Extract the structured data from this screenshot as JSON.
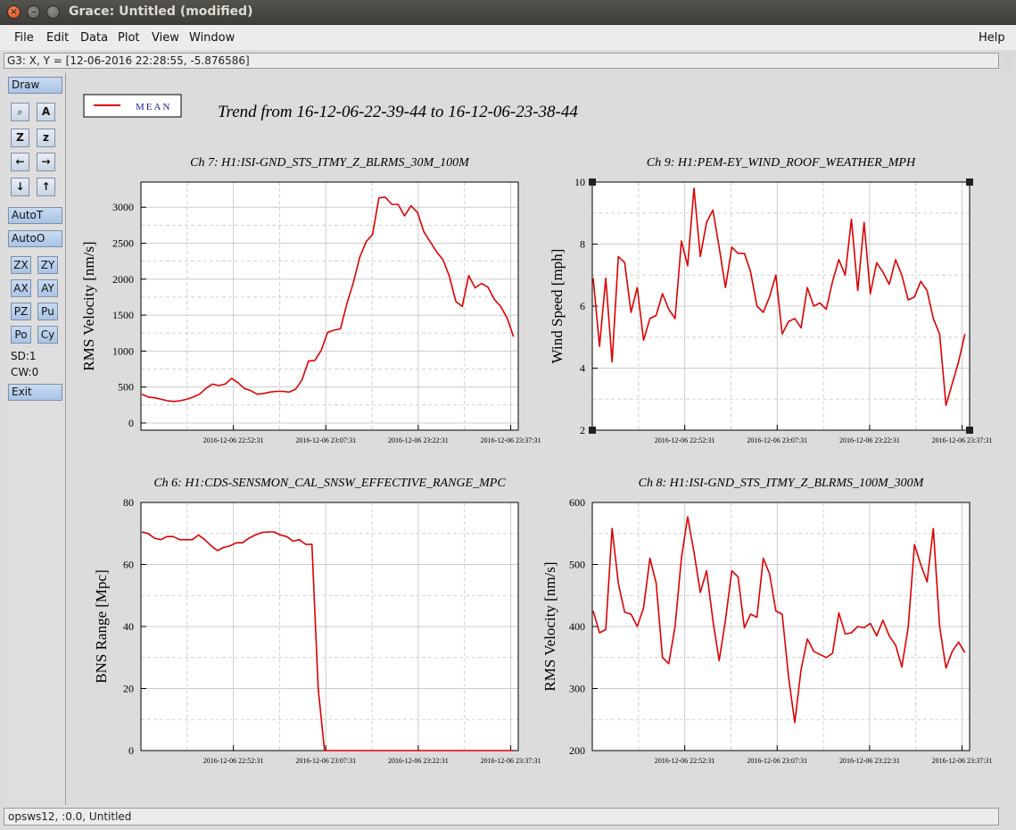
{
  "window": {
    "title": "Grace: Untitled (modified)",
    "close_glyph": "×",
    "minimize_glyph": "–"
  },
  "menubar": {
    "items": [
      {
        "label": "File",
        "accel": "F"
      },
      {
        "label": "Edit",
        "accel": "E"
      },
      {
        "label": "Data",
        "accel": "D"
      },
      {
        "label": "Plot",
        "accel": "P"
      },
      {
        "label": "View",
        "accel": "V"
      },
      {
        "label": "Window",
        "accel": "W"
      }
    ],
    "help": "Help"
  },
  "locator": "G3: X, Y = [12-06-2016 22:28:55, -5.876586]",
  "toolbar": {
    "draw": "Draw",
    "icons": [
      {
        "name": "zoom-icon",
        "glyph": "🔍"
      },
      {
        "name": "text-icon",
        "glyph": "A"
      },
      {
        "name": "zoom-z-icon",
        "glyph": "Z"
      },
      {
        "name": "zoom-out-icon",
        "glyph": "z"
      },
      {
        "name": "arrow-left-icon",
        "glyph": "←"
      },
      {
        "name": "arrow-right-icon",
        "glyph": "→"
      },
      {
        "name": "arrow-down-icon",
        "glyph": "↓"
      },
      {
        "name": "arrow-up-icon",
        "glyph": "↑"
      }
    ],
    "autot": "AutoT",
    "autoo": "AutoO",
    "small": [
      "ZX",
      "ZY",
      "AX",
      "AY",
      "PZ",
      "Pu",
      "Po",
      "Cy"
    ],
    "sd": "SD:1",
    "cw": "CW:0",
    "exit": "Exit"
  },
  "status": "opsws12, :0.0, Untitled",
  "legend": {
    "label": "MEAN",
    "color": "#dd0000"
  },
  "title": "Trend from 16-12-06-22-39-44 to 16-12-06-23-38-44",
  "chart_data": [
    {
      "type": "line",
      "title": "Ch 7: H1:ISI-GND_STS_ITMY_Z_BLRMS_30M_100M",
      "ylabel": "RMS Velocity [nm/s]",
      "xlabel": "",
      "xticks": [
        "2016-12-06 22:52:31",
        "2016-12-06 23:07:31",
        "2016-12-06 23:22:31",
        "2016-12-06 23:37:31"
      ],
      "yticks": [
        0,
        500,
        1000,
        1500,
        2000,
        2500,
        3000
      ],
      "ylim": [
        -100,
        3350
      ],
      "grid": true,
      "series": [
        {
          "name": "MEAN",
          "color": "#dd0000",
          "values": [
            400,
            360,
            350,
            330,
            310,
            300,
            310,
            330,
            360,
            400,
            480,
            540,
            520,
            540,
            620,
            560,
            480,
            450,
            400,
            410,
            430,
            440,
            440,
            430,
            470,
            600,
            860,
            870,
            1010,
            1260,
            1290,
            1310,
            1660,
            1950,
            2300,
            2520,
            2620,
            3130,
            3140,
            3040,
            3040,
            2880,
            3020,
            2930,
            2660,
            2520,
            2380,
            2270,
            2040,
            1690,
            1620,
            2050,
            1880,
            1940,
            1890,
            1720,
            1620,
            1460,
            1200
          ]
        }
      ]
    },
    {
      "type": "line",
      "title": "Ch 9: H1:PEM-EY_WIND_ROOF_WEATHER_MPH",
      "ylabel": "Wind Speed [mph]",
      "xlabel": "",
      "xticks": [
        "2016-12-06 22:52:31",
        "2016-12-06 23:07:31",
        "2016-12-06 23:22:31",
        "2016-12-06 23:37:31"
      ],
      "yticks": [
        2,
        4,
        6,
        8,
        10
      ],
      "ylim": [
        2,
        10
      ],
      "grid": true,
      "series": [
        {
          "name": "MEAN",
          "color": "#dd0000",
          "values": [
            6.9,
            4.7,
            6.9,
            4.2,
            7.6,
            7.4,
            5.8,
            6.6,
            4.9,
            5.6,
            5.7,
            6.4,
            5.9,
            5.6,
            8.1,
            7.3,
            9.8,
            7.6,
            8.7,
            9.1,
            7.9,
            6.6,
            7.9,
            7.7,
            7.7,
            7.1,
            6.0,
            5.8,
            6.3,
            7.0,
            5.1,
            5.5,
            5.6,
            5.3,
            6.6,
            6.0,
            6.1,
            5.9,
            6.8,
            7.5,
            7.0,
            8.8,
            6.5,
            8.7,
            6.4,
            7.4,
            7.1,
            6.7,
            7.5,
            7.0,
            6.2,
            6.3,
            6.8,
            6.5,
            5.6,
            5.1,
            2.8,
            3.5,
            4.2,
            5.1
          ]
        }
      ]
    },
    {
      "type": "line",
      "title": "Ch 6: H1:CDS-SENSMON_CAL_SNSW_EFFECTIVE_RANGE_MPC",
      "ylabel": "BNS Range [Mpc]",
      "xlabel": "",
      "xticks": [
        "2016-12-06 22:52:31",
        "2016-12-06 23:07:31",
        "2016-12-06 23:22:31",
        "2016-12-06 23:37:31"
      ],
      "yticks": [
        0,
        20,
        40,
        60,
        80
      ],
      "ylim": [
        0,
        80
      ],
      "grid": true,
      "series": [
        {
          "name": "MEAN",
          "color": "#dd0000",
          "values": [
            70.5,
            70,
            68.5,
            68,
            69,
            69,
            68,
            68,
            68,
            69.5,
            68,
            66,
            64.5,
            65.5,
            66,
            67,
            67,
            68.5,
            69.5,
            70.3,
            70.5,
            70.5,
            69.5,
            69,
            67.5,
            68,
            66.5,
            66.5,
            20,
            0,
            0,
            0,
            0,
            0,
            0,
            0,
            0,
            0,
            0,
            0,
            0,
            0,
            0,
            0,
            0,
            0,
            0,
            0,
            0,
            0,
            0,
            0,
            0,
            0,
            0,
            0,
            0,
            0,
            0,
            0
          ]
        }
      ]
    },
    {
      "type": "line",
      "title": "Ch 8: H1:ISI-GND_STS_ITMY_Z_BLRMS_100M_300M",
      "ylabel": "RMS Velocity [nm/s]",
      "xlabel": "",
      "xticks": [
        "2016-12-06 22:52:31",
        "2016-12-06 23:07:31",
        "2016-12-06 23:22:31",
        "2016-12-06 23:37:31"
      ],
      "yticks": [
        200,
        300,
        400,
        500,
        600
      ],
      "ylim": [
        200,
        600
      ],
      "grid": true,
      "series": [
        {
          "name": "MEAN",
          "color": "#dd0000",
          "values": [
            425,
            390,
            395,
            558,
            470,
            423,
            420,
            400,
            430,
            510,
            470,
            350,
            340,
            400,
            510,
            577,
            520,
            455,
            490,
            410,
            345,
            410,
            490,
            480,
            398,
            420,
            415,
            510,
            485,
            425,
            420,
            320,
            245,
            330,
            380,
            360,
            355,
            350,
            357,
            422,
            388,
            390,
            400,
            398,
            405,
            385,
            410,
            385,
            370,
            335,
            398,
            532,
            500,
            472,
            558,
            400,
            333,
            360,
            375,
            358
          ]
        }
      ]
    }
  ]
}
